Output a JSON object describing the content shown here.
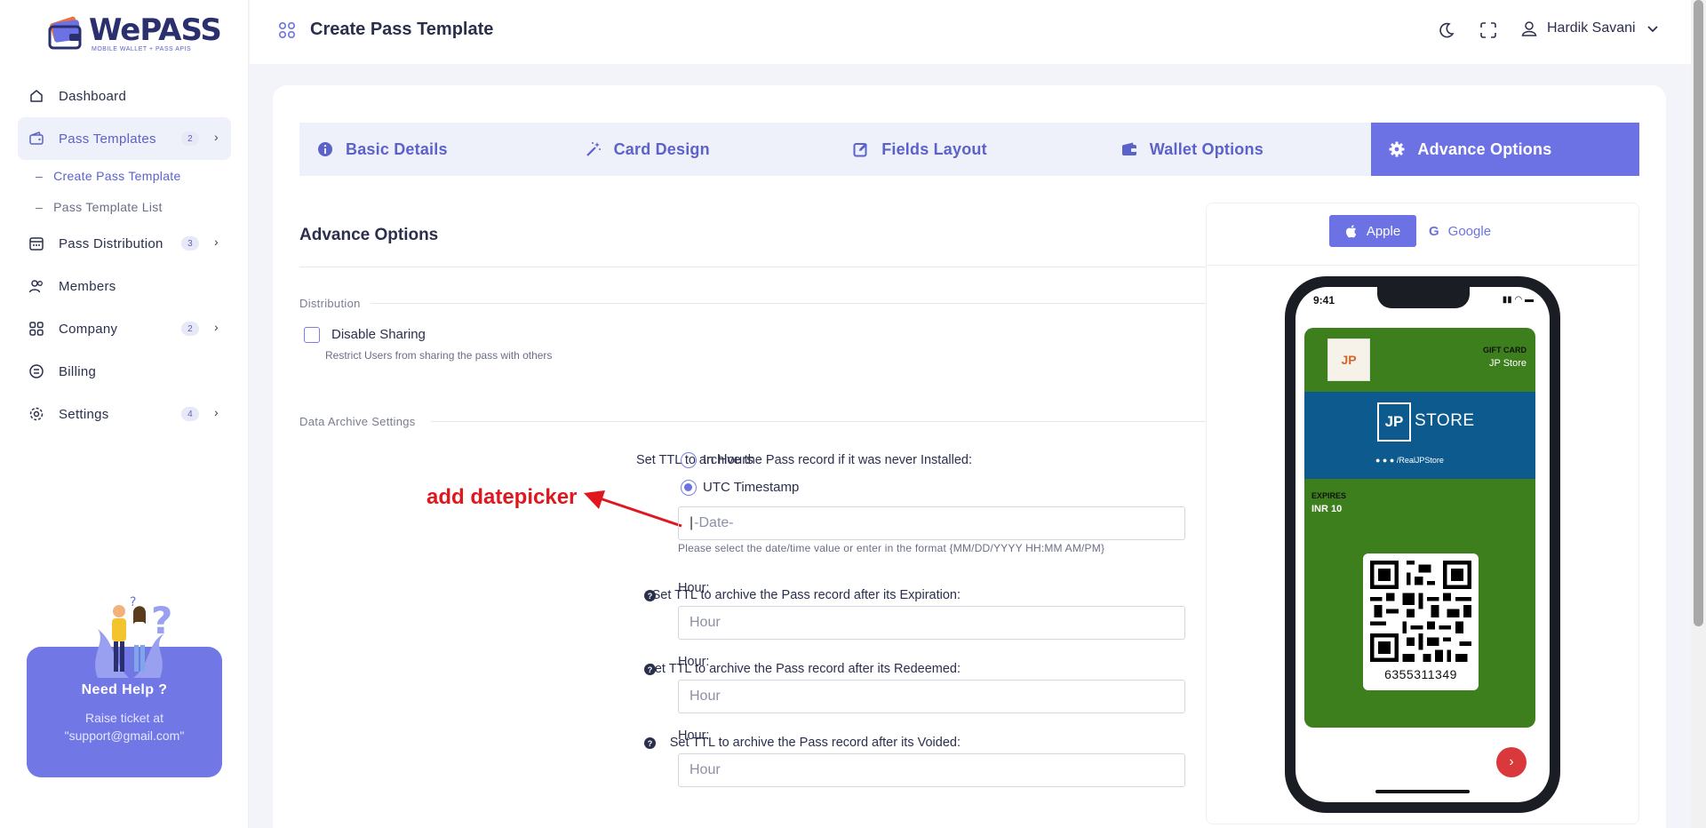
{
  "app": {
    "logo_word": "WePASS",
    "logo_tagline": "MOBILE WALLET + PASS APIS"
  },
  "sidebar": {
    "items": [
      {
        "label": "Dashboard"
      },
      {
        "label": "Pass Templates",
        "badge": "2"
      },
      {
        "label": "Pass Distribution",
        "badge": "3"
      },
      {
        "label": "Members"
      },
      {
        "label": "Company",
        "badge": "2"
      },
      {
        "label": "Billing"
      },
      {
        "label": "Settings",
        "badge": "4"
      }
    ],
    "sub_items": [
      {
        "label": "Create Pass Template"
      },
      {
        "label": "Pass Template List"
      }
    ],
    "help": {
      "title": "Need Help ?",
      "text": "Raise ticket at \"support@gmail.com\""
    }
  },
  "header": {
    "title": "Create Pass Template",
    "user_name": "Hardik Savani"
  },
  "tabs": [
    {
      "label": "Basic Details"
    },
    {
      "label": "Card Design"
    },
    {
      "label": "Fields Layout"
    },
    {
      "label": "Wallet Options"
    },
    {
      "label": "Advance Options"
    }
  ],
  "form": {
    "section_title": "Advance Options",
    "distribution_label": "Distribution",
    "disable_sharing_label": "Disable Sharing",
    "disable_sharing_hint": "Restrict Users from sharing the pass with others",
    "archive_label": "Data Archive Settings",
    "ttl_never_installed_label": "Set TTL to archive the Pass record if it was never Installed:",
    "radio_hours": "In Hours",
    "radio_utc": "UTC Timestamp",
    "date_placeholder": "-Date-",
    "date_hint": "Please select the date/time value or enter in the format {MM/DD/YYYY HH:MM AM/PM}",
    "ttl_expiration_label": "Set TTL to archive the Pass record after its Expiration:",
    "ttl_redeemed_label": "Set TTL to archive the Pass record after its Redeemed:",
    "ttl_voided_label": "Set TTL to archive the Pass record after its Voided:",
    "hour_label": "Hour:",
    "hour_placeholder": "Hour",
    "help_mark": "?",
    "annotation": "add datepicker"
  },
  "preview": {
    "apple_label": "Apple",
    "google_label": "Google",
    "status_time": "9:41",
    "pass_type": "GIFT CARD",
    "store_name": "JP Store",
    "banner_jp": "JP",
    "banner_store": "STORE",
    "banner_social": "/RealJPStore",
    "expires_label": "EXPIRES",
    "expires_value": "INR 10",
    "barcode_number": "6355311349"
  },
  "colors": {
    "accent": "#6c72e4",
    "pass_background": "#3d7f1c",
    "banner": "#0c5a8e",
    "annotation": "#e0171f"
  }
}
